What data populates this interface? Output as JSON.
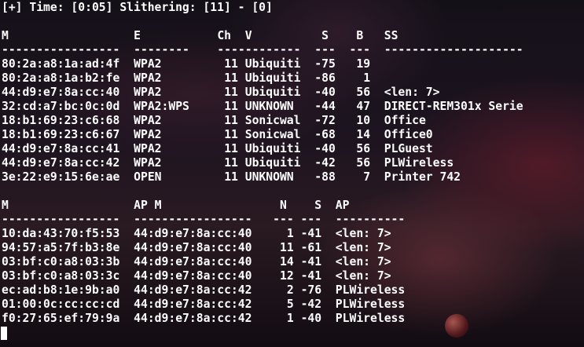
{
  "status_line": "[+] Time: [0:05] Slithering: [11] - [0]",
  "ap_table": {
    "headers": {
      "mac": "M",
      "enc": "E",
      "ch": "Ch",
      "vendor": "V",
      "signal": "S",
      "beacons": "B",
      "ssid": "SS"
    },
    "separators": {
      "mac": "-----------------",
      "enc": "--------",
      "ch": "----",
      "vendor": "--------",
      "signal": "---",
      "beacons": "---",
      "ssid": "--------------------"
    },
    "rows": [
      {
        "mac": "80:2a:a8:1a:ad:4f",
        "enc": "WPA2",
        "ch": "11",
        "vendor": "Ubiquiti",
        "signal": "-75",
        "beacons": "19",
        "ssid": ""
      },
      {
        "mac": "80:2a:a8:1a:b2:fe",
        "enc": "WPA2",
        "ch": "11",
        "vendor": "Ubiquiti",
        "signal": "-86",
        "beacons": "1",
        "ssid": ""
      },
      {
        "mac": "44:d9:e7:8a:cc:40",
        "enc": "WPA2",
        "ch": "11",
        "vendor": "Ubiquiti",
        "signal": "-40",
        "beacons": "56",
        "ssid": "<len: 7>"
      },
      {
        "mac": "32:cd:a7:bc:0c:0d",
        "enc": "WPA2:WPS",
        "ch": "11",
        "vendor": "UNKNOWN",
        "signal": "-44",
        "beacons": "47",
        "ssid": "DIRECT-REM301x Serie"
      },
      {
        "mac": "18:b1:69:23:c6:68",
        "enc": "WPA2",
        "ch": "11",
        "vendor": "Sonicwal",
        "signal": "-72",
        "beacons": "10",
        "ssid": "Office"
      },
      {
        "mac": "18:b1:69:23:c6:67",
        "enc": "WPA2",
        "ch": "11",
        "vendor": "Sonicwal",
        "signal": "-68",
        "beacons": "14",
        "ssid": "Office0"
      },
      {
        "mac": "44:d9:e7:8a:cc:41",
        "enc": "WPA2",
        "ch": "11",
        "vendor": "Ubiquiti",
        "signal": "-40",
        "beacons": "56",
        "ssid": "PLGuest"
      },
      {
        "mac": "44:d9:e7:8a:cc:42",
        "enc": "WPA2",
        "ch": "11",
        "vendor": "Ubiquiti",
        "signal": "-42",
        "beacons": "56",
        "ssid": "PLWireless"
      },
      {
        "mac": "3e:22:e9:15:6e:ae",
        "enc": "OPEN",
        "ch": "11",
        "vendor": "UNKNOWN",
        "signal": "-88",
        "beacons": "7",
        "ssid": "Printer 742"
      }
    ]
  },
  "client_table": {
    "headers": {
      "mac": "M",
      "ap_mac": "AP M",
      "n": "N",
      "signal": "S",
      "ap": "AP"
    },
    "separators": {
      "mac": "-----------------",
      "ap_mac": "-----------------",
      "n": "---",
      "signal": "---",
      "ap": "----------"
    },
    "rows": [
      {
        "mac": "10:da:43:70:f5:53",
        "ap_mac": "44:d9:e7:8a:cc:40",
        "n": "1",
        "signal": "-41",
        "ap": "<len: 7>"
      },
      {
        "mac": "94:57:a5:7f:b3:8e",
        "ap_mac": "44:d9:e7:8a:cc:40",
        "n": "11",
        "signal": "-61",
        "ap": "<len: 7>"
      },
      {
        "mac": "03:bf:c0:a8:03:3b",
        "ap_mac": "44:d9:e7:8a:cc:40",
        "n": "14",
        "signal": "-41",
        "ap": "<len: 7>"
      },
      {
        "mac": "03:bf:c0:a8:03:3c",
        "ap_mac": "44:d9:e7:8a:cc:40",
        "n": "12",
        "signal": "-41",
        "ap": "<len: 7>"
      },
      {
        "mac": "ec:ad:b8:1e:9b:a0",
        "ap_mac": "44:d9:e7:8a:cc:42",
        "n": "2",
        "signal": "-76",
        "ap": "PLWireless"
      },
      {
        "mac": "01:00:0c:cc:cc:cd",
        "ap_mac": "44:d9:e7:8a:cc:42",
        "n": "5",
        "signal": "-42",
        "ap": "PLWireless"
      },
      {
        "mac": "f0:27:65:ef:79:9a",
        "ap_mac": "44:d9:e7:8a:cc:42",
        "n": "1",
        "signal": "-40",
        "ap": "PLWireless"
      }
    ]
  },
  "colors": {
    "text": "#ffffff",
    "background": "#07060c"
  }
}
